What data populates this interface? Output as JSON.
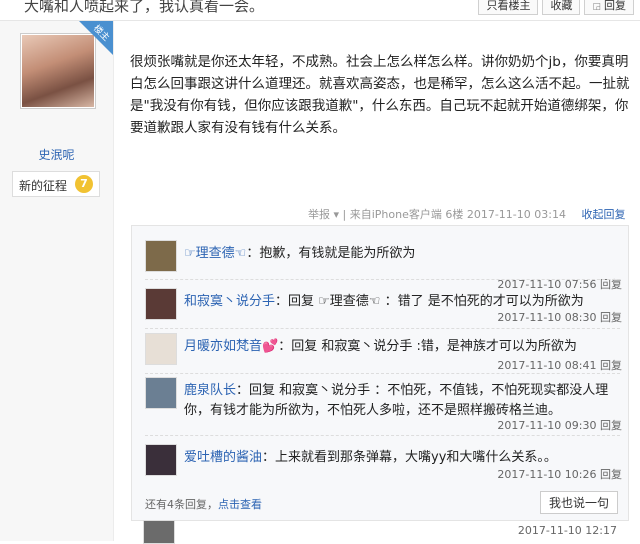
{
  "topbar": {
    "title": "大嘴和人喷起来了，我认真看一会。",
    "buttons": [
      {
        "label": "只看楼主",
        "icon": ""
      },
      {
        "label": "收藏",
        "icon": ""
      },
      {
        "label": "回复",
        "icon": "reply-icon"
      }
    ]
  },
  "author": {
    "badge": "楼主",
    "name": "史泯呢",
    "rank_label": "新的征程",
    "rank_level": "7"
  },
  "post": {
    "text": "很烦张嘴就是你还太年轻，不成熟。社会上怎么样怎么样。讲你奶奶个jb，你要真明白怎么回事跟这讲什么道理还。就喜欢高姿态，也是稀罕，怎么这么活不起。一扯就是\"我没有你有钱，但你应该跟我道歉\"，什么东西。自己玩不起就开始道德绑架，你要道歉跟人家有没有钱有什么关系。",
    "meta": "举报 ▾ | 来自iPhone客户端  6楼  2017-11-10 03:14",
    "reply_toggle": "收起回复"
  },
  "replies": [
    {
      "user": "☞理查德☜",
      "text": "：抱歉，有钱就是能为所欲为",
      "time": "2017-11-10 07:56",
      "reply_label": "回复"
    },
    {
      "user": "和寂寞丶说分手",
      "text": "：回复 ☞理查德☜ ：错了 是不怕死的才可以为所欲为",
      "time": "2017-11-10 08:30",
      "reply_label": "回复"
    },
    {
      "user": "月暖亦如梵音💕",
      "text": "：回复 和寂寞丶说分手 :错，是神族才可以为所欲为",
      "time": "2017-11-10 08:41",
      "reply_label": "回复"
    },
    {
      "user": "鹿泉队长",
      "text": "：回复 和寂寞丶说分手 ：不怕死，不值钱，不怕死现实都没人理你，有钱才能为所欲为，不怕死人多啦，还不是照样搬砖格兰迪。",
      "time": "2017-11-10 09:30",
      "reply_label": "回复"
    },
    {
      "user": "爱吐槽的酱油",
      "text": "：上来就看到那条弹幕，大嘴yy和大嘴什么关系。。",
      "time": "2017-11-10 10:26",
      "reply_label": "回复"
    }
  ],
  "more": {
    "count_text": "还有4条回复，",
    "link": "点击查看",
    "say_button": "我也说一句"
  },
  "bottom": {
    "time": "2017-11-10 12:17"
  }
}
